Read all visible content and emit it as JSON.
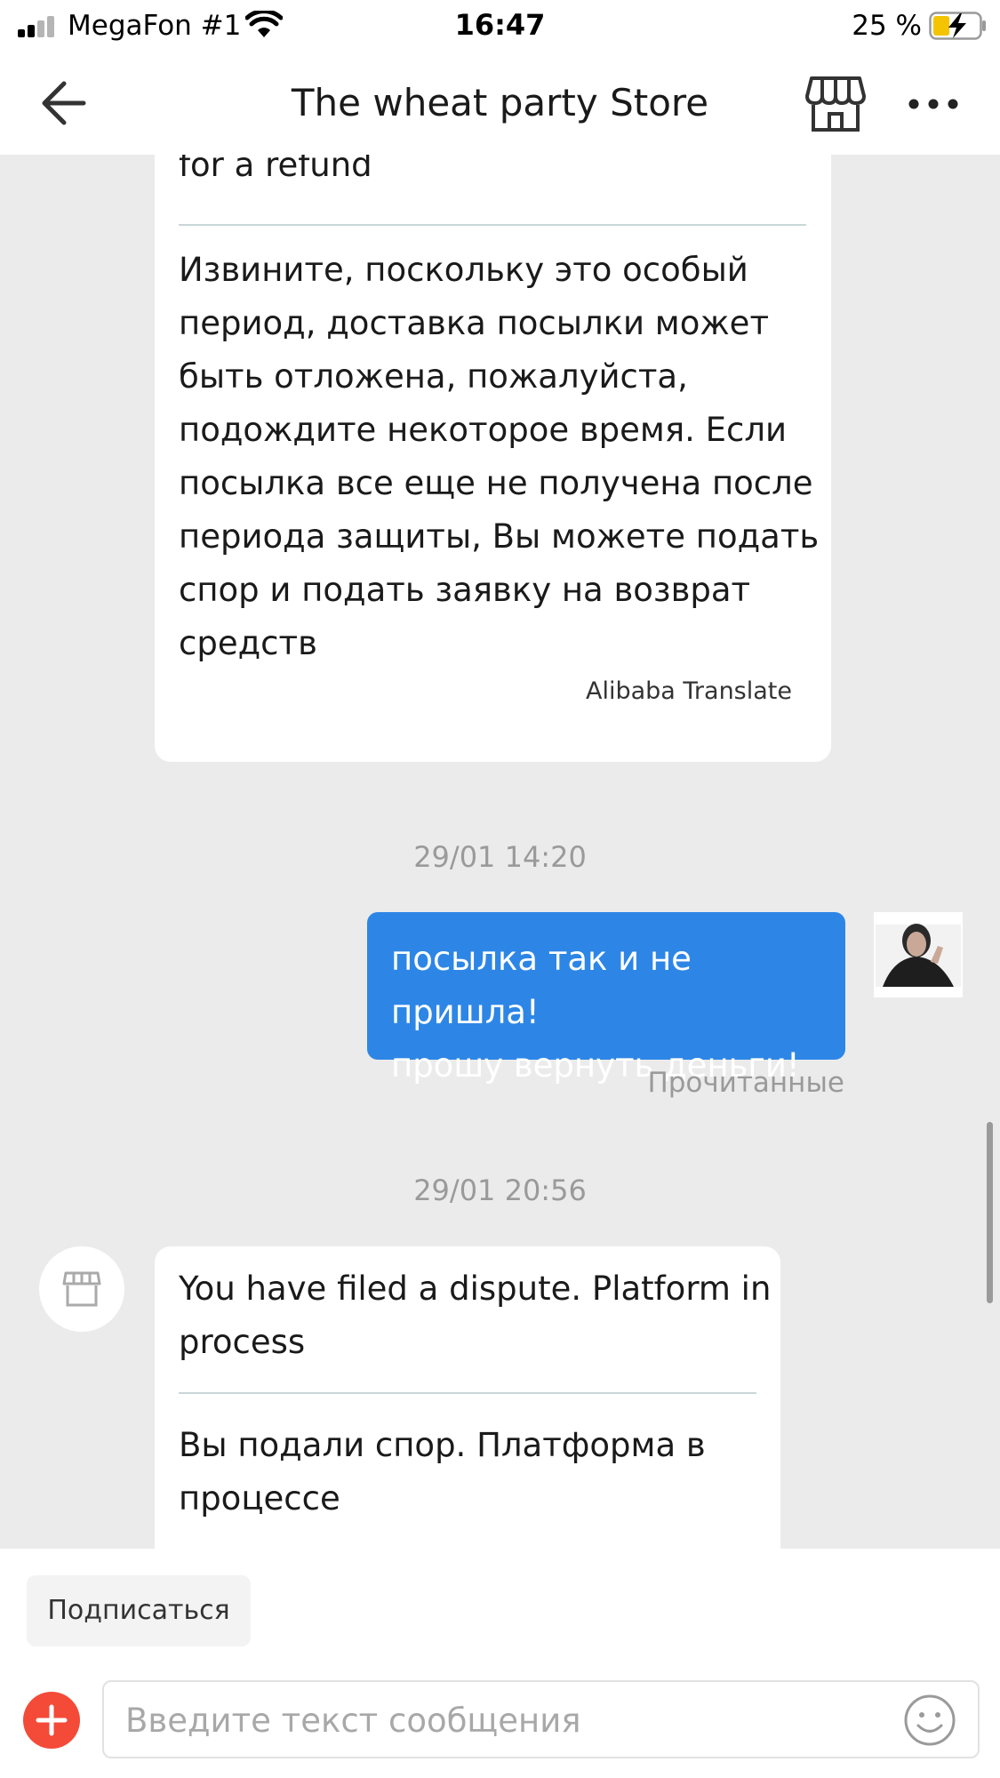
{
  "status_bar": {
    "carrier": "MegaFon #1",
    "time": "16:47",
    "battery": "25 %",
    "battery_level": 0.25,
    "icons": [
      "signal-icon",
      "wifi-icon",
      "battery-charging-icon"
    ]
  },
  "header": {
    "title": "The wheat party Store",
    "icons": [
      "back-arrow-icon",
      "store-icon",
      "more-icon"
    ]
  },
  "messages": {
    "first": {
      "english_tail": "for a refund",
      "russian_lines": [
        "Извините, поскольку это особый",
        "период, доставка посылки может",
        "быть отложена, пожалуйста,",
        "подождите некоторое время. Если",
        "посылка все еще не получена после",
        "периода защиты, Вы можете подать",
        "спор и подать заявку на возврат",
        "средств"
      ],
      "translate_label": "Alibaba Translate"
    },
    "timestamp_1": "29/01 14:20",
    "outgoing": {
      "lines": [
        "посылка так и не пришла!",
        "прошу вернуть деньги!"
      ],
      "status": "Прочитанные"
    },
    "timestamp_2": "29/01 20:56",
    "second": {
      "english_lines": [
        "You have filed a dispute. Platform in",
        "process"
      ],
      "russian_lines": [
        "Вы подали спор. Платформа в",
        "процессе"
      ]
    }
  },
  "bottom": {
    "subscribe_label": "Подписаться",
    "input_placeholder": "Введите текст сообщения",
    "icons": [
      "plus-icon",
      "emoji-icon"
    ]
  },
  "colors": {
    "outgoing_bubble": "#2d86e6",
    "plus_button": "#f44a38",
    "chat_background": "#ebebeb",
    "battery_fill": "#f5c400"
  }
}
